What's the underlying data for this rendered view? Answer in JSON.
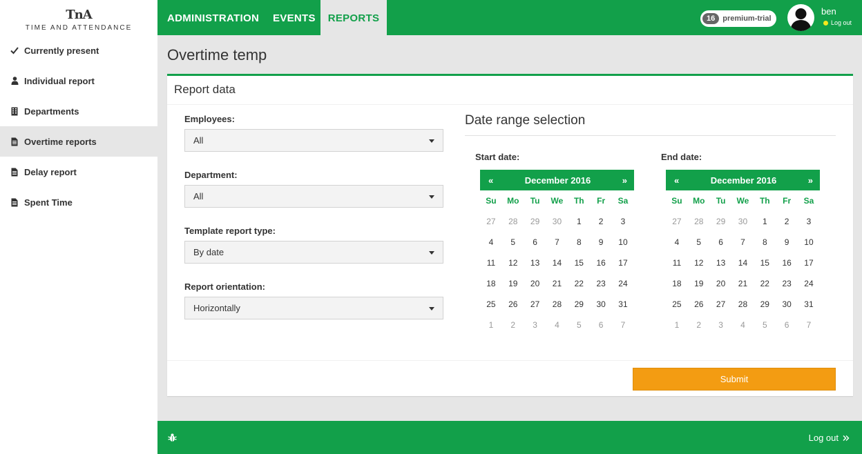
{
  "app": {
    "logo_mark": "TnA",
    "logo_text": "TIME AND ATTENDANCE"
  },
  "sidebar": {
    "items": [
      {
        "label": "Currently present",
        "icon": "check-icon"
      },
      {
        "label": "Individual report",
        "icon": "user-icon"
      },
      {
        "label": "Departments",
        "icon": "building-icon"
      },
      {
        "label": "Overtime reports",
        "icon": "file-icon",
        "active": true
      },
      {
        "label": "Delay report",
        "icon": "file-icon"
      },
      {
        "label": "Spent Time",
        "icon": "file-icon"
      }
    ]
  },
  "topbar": {
    "tabs": [
      "ADMINISTRATION",
      "EVENTS",
      "REPORTS"
    ],
    "active_tab": "REPORTS",
    "badge_count": "16",
    "badge_label": "premium-trial",
    "user_name": "ben",
    "logout_label": "Log out"
  },
  "main": {
    "page_title": "Overtime temp",
    "panel_title": "Report data",
    "fields": [
      {
        "label": "Employees:",
        "value": "All"
      },
      {
        "label": "Department:",
        "value": "All"
      },
      {
        "label": "Template report type:",
        "value": "By date"
      },
      {
        "label": "Report orientation:",
        "value": "Horizontally"
      }
    ],
    "date_range_title": "Date range selection",
    "start_label": "Start date:",
    "end_label": "End date:",
    "calendar": {
      "month": "December 2016",
      "prev": "«",
      "next": "»",
      "weekdays": [
        "Su",
        "Mo",
        "Tu",
        "We",
        "Th",
        "Fr",
        "Sa"
      ],
      "weeks": [
        [
          "27",
          "28",
          "29",
          "30",
          "1",
          "2",
          "3"
        ],
        [
          "4",
          "5",
          "6",
          "7",
          "8",
          "9",
          "10"
        ],
        [
          "11",
          "12",
          "13",
          "14",
          "15",
          "16",
          "17"
        ],
        [
          "18",
          "19",
          "20",
          "21",
          "22",
          "23",
          "24"
        ],
        [
          "25",
          "26",
          "27",
          "28",
          "29",
          "30",
          "31"
        ],
        [
          "1",
          "2",
          "3",
          "4",
          "5",
          "6",
          "7"
        ]
      ]
    },
    "submit_label": "Submit"
  },
  "footer": {
    "logout_label": "Log out",
    "logout_icon": "double-chevron-right-icon",
    "bug_icon": "bug-icon"
  },
  "colors": {
    "brand_green": "#12a04a",
    "submit_orange": "#f39c12",
    "status_dot": "#f5e81c"
  }
}
